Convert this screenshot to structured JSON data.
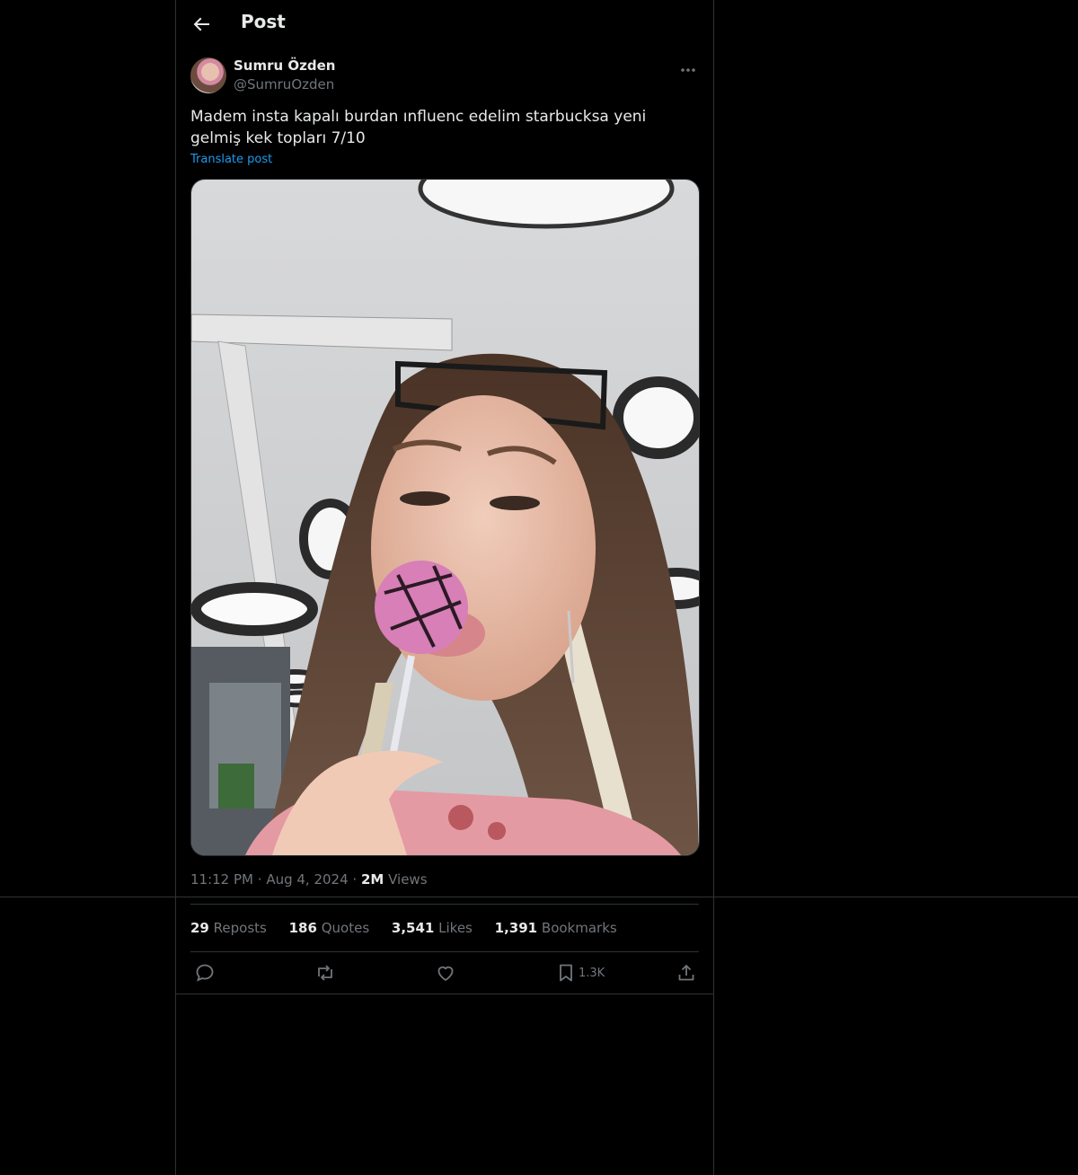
{
  "header": {
    "title": "Post",
    "back_icon": "arrow-left-icon"
  },
  "author": {
    "name": "Sumru Özden",
    "handle": "@SumruOzden"
  },
  "post": {
    "text": "Madem insta kapalı burdan ınfluenc edelim starbucksa yeni gelmiş kek topları 7/10",
    "translate_label": "Translate post",
    "time": "11:12 PM",
    "date": "Aug 4, 2024",
    "views_count": "2M",
    "views_label": "Views"
  },
  "stats": {
    "reposts_count": "29",
    "reposts_label": "Reposts",
    "quotes_count": "186",
    "quotes_label": "Quotes",
    "likes_count": "3,541",
    "likes_label": "Likes",
    "bookmarks_count": "1,391",
    "bookmarks_label": "Bookmarks"
  },
  "actions": {
    "reply_icon": "reply-icon",
    "repost_icon": "repost-icon",
    "like_icon": "heart-icon",
    "bookmark_icon": "bookmark-icon",
    "bookmark_count": "1.3K",
    "share_icon": "share-icon"
  },
  "colors": {
    "background": "#000000",
    "border": "#2f3336",
    "text_primary": "#e7e9ea",
    "text_secondary": "#71767b",
    "link": "#1d9bf0"
  }
}
